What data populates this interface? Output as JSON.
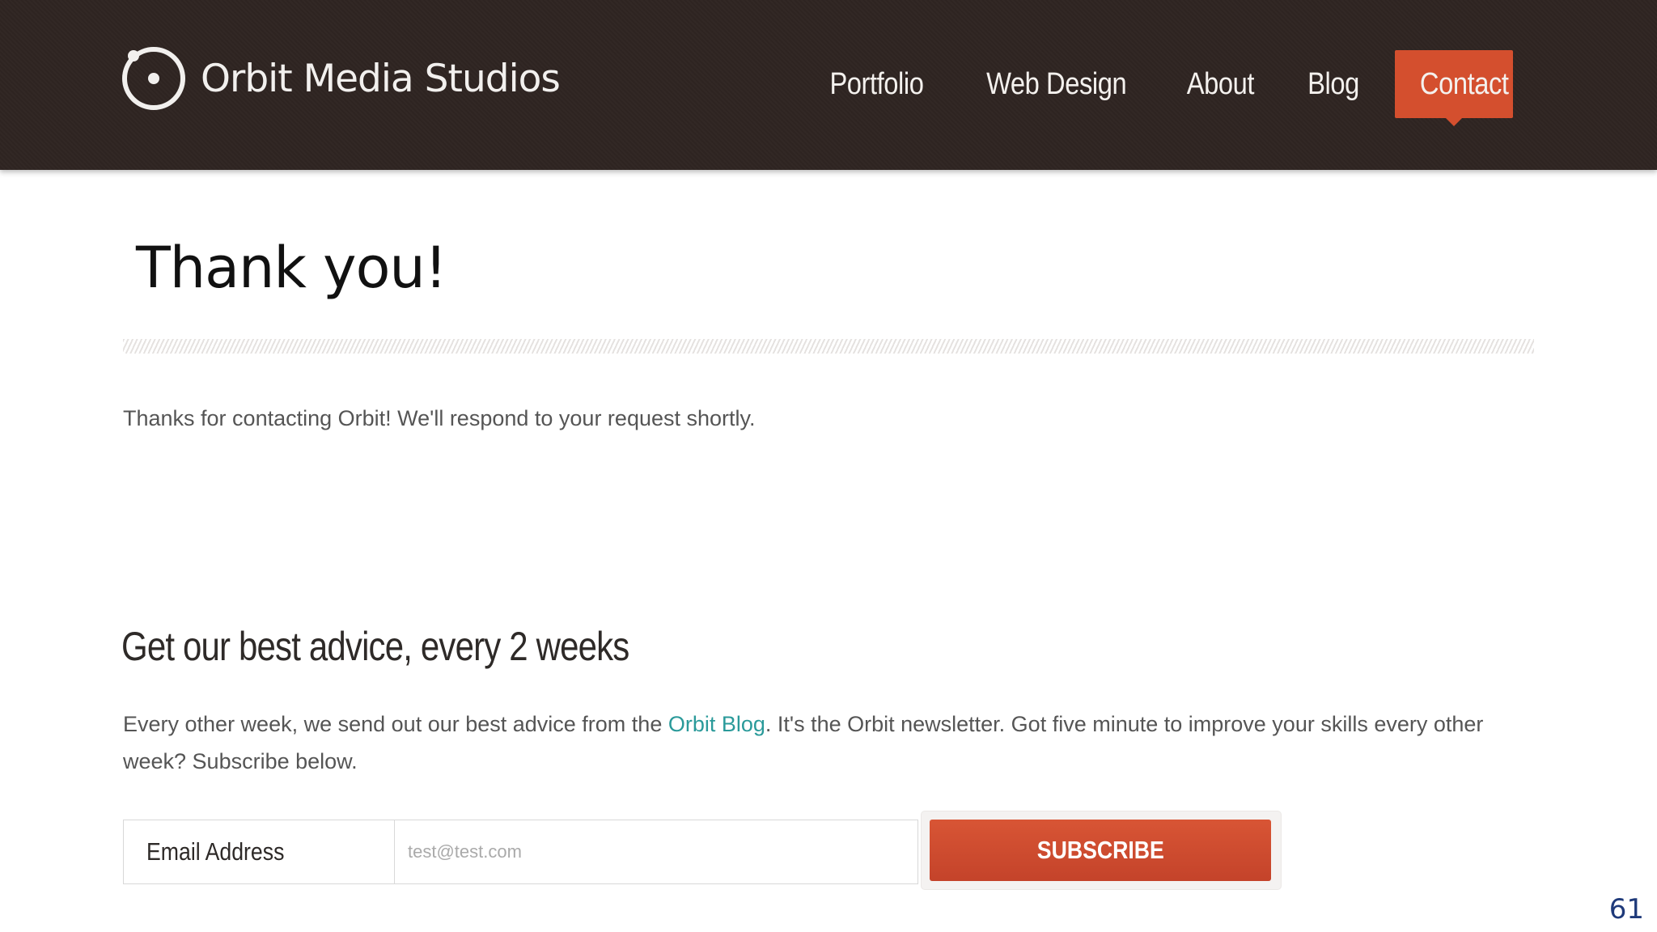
{
  "header": {
    "logo_text": "Orbit Media Studios",
    "logo_icon": "orbit-logo-icon",
    "nav_items": [
      {
        "label": "Portfolio",
        "active": false
      },
      {
        "label": "Web Design",
        "active": false
      },
      {
        "label": "About",
        "active": false
      },
      {
        "label": "Blog",
        "active": false
      },
      {
        "label": "Contact",
        "active": true
      }
    ]
  },
  "main": {
    "title": "Thank you!",
    "message": "Thanks for contacting Orbit! We'll respond to your request shortly."
  },
  "newsletter": {
    "title": "Get our best advice, every 2 weeks",
    "text_before_link": "Every other week, we send out our best advice from the ",
    "link_text": "Orbit Blog",
    "text_after_link": ". It's the Orbit newsletter. Got five minute to improve your skills every other week? Subscribe below.",
    "email_label": "Email Address",
    "email_value": "",
    "email_placeholder": "test@test.com",
    "subscribe_label": "SUBSCRIBE"
  },
  "slide": {
    "number": "61"
  },
  "colors": {
    "header_bg": "#2f2522",
    "accent": "#d44f2e",
    "link": "#2a9a9a",
    "body_text": "#555555",
    "slide_number": "#1f3a7a"
  }
}
